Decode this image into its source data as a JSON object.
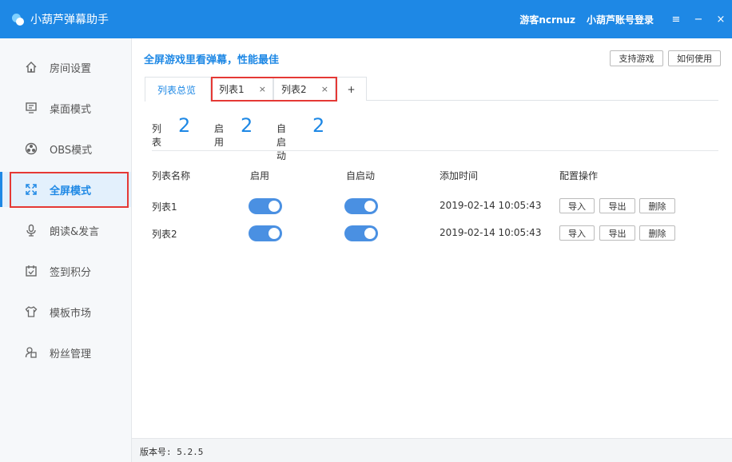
{
  "app": {
    "title": "小葫芦弹幕助手",
    "user": "游客ncrnuz",
    "login": "小葫芦账号登录",
    "controls": [
      "≡",
      "−",
      "×"
    ],
    "accent": "#1e88e5",
    "highlight": "#e53935"
  },
  "sidebar": {
    "items": [
      {
        "label": "房间设置",
        "icon": "home-icon"
      },
      {
        "label": "桌面模式",
        "icon": "monitor-icon"
      },
      {
        "label": "OBS模式",
        "icon": "obs-icon"
      },
      {
        "label": "全屏模式",
        "icon": "fullscreen-icon"
      },
      {
        "label": "朗读&发言",
        "icon": "microphone-icon"
      },
      {
        "label": "签到积分",
        "icon": "calendar-check-icon"
      },
      {
        "label": "模板市场",
        "icon": "shirt-icon"
      },
      {
        "label": "粉丝管理",
        "icon": "fan-manage-icon"
      }
    ],
    "active": "全屏模式"
  },
  "main": {
    "headline": "全屏游戏里看弹幕，性能最佳",
    "buttons": {
      "supported_games": "支持游戏",
      "how_to_use": "如何使用"
    },
    "tabs": [
      {
        "label": "列表总览"
      },
      {
        "label": "列表1",
        "close": "×"
      },
      {
        "label": "列表2",
        "close": "×"
      },
      {
        "label": "+"
      }
    ],
    "stats": [
      {
        "label": "列表",
        "value": "2"
      },
      {
        "label": "启用",
        "value": "2"
      },
      {
        "label": "自启动",
        "value": "2"
      }
    ],
    "table": {
      "headers": [
        "列表名称",
        "启用",
        "自启动",
        "添加时间",
        "配置操作"
      ],
      "rows": [
        {
          "name": "列表1",
          "enabled": true,
          "autostart": true,
          "added": "2019-02-14 10:05:43"
        },
        {
          "name": "列表2",
          "enabled": true,
          "autostart": true,
          "added": "2019-02-14 10:05:43"
        }
      ],
      "actions": {
        "import": "导入",
        "export": "导出",
        "delete": "删除"
      }
    }
  },
  "footer": {
    "version": "版本号: 5.2.5"
  }
}
